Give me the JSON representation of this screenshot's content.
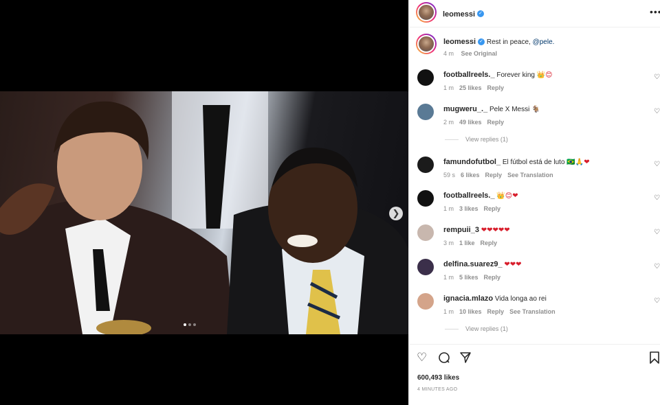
{
  "post": {
    "username": "leomessi",
    "caption_text": "Rest in peace, ",
    "caption_mention": "@pele.",
    "caption_time": "4 m",
    "see_original": "See Original",
    "likes": "600,493 likes",
    "time_ago": "4 MINUTES AGO"
  },
  "carousel": {
    "next": "❯",
    "slides": 3,
    "active_slide": 1
  },
  "comments": [
    {
      "user": "footballreels._",
      "text": "Forever king",
      "emoji": "👑😊",
      "time": "1 m",
      "likes": "25 likes",
      "reply": "Reply",
      "extra": "",
      "avatar": "#111111"
    },
    {
      "user": "mugweru_._",
      "text": "Pele X Messi",
      "emoji": "🐐",
      "time": "2 m",
      "likes": "49 likes",
      "reply": "Reply",
      "extra": "",
      "avatar": "#5a7a95",
      "view_replies": "View replies (1)"
    },
    {
      "user": "famundofutbol_",
      "text": "El fútbol está de luto",
      "emoji": "🇧🇷🙏❤",
      "time": "59 s",
      "likes": "6 likes",
      "reply": "Reply",
      "extra": "See Translation",
      "avatar": "#1b1b1b"
    },
    {
      "user": "footballreels._",
      "text": "",
      "emoji": "👑😊❤",
      "time": "1 m",
      "likes": "3 likes",
      "reply": "Reply",
      "extra": "",
      "avatar": "#111111"
    },
    {
      "user": "rempuii_3",
      "text": "",
      "emoji": "❤❤❤❤❤",
      "time": "3 m",
      "likes": "1 like",
      "reply": "Reply",
      "extra": "",
      "avatar": "#c8b7ae"
    },
    {
      "user": "delfina.suarez9_",
      "text": "",
      "emoji": "❤❤❤",
      "time": "1 m",
      "likes": "5 likes",
      "reply": "Reply",
      "extra": "",
      "avatar": "#3b2f4a"
    },
    {
      "user": "ignacia.mlazo",
      "text": "Vida longa ao rei",
      "emoji": "",
      "time": "1 m",
      "likes": "10 likes",
      "reply": "Reply",
      "extra": "See Translation",
      "avatar": "#d4a48a",
      "view_replies": "View replies (1)"
    }
  ],
  "icons": {
    "like": "heart-icon",
    "comment": "comment-icon",
    "share": "share-icon",
    "save": "bookmark-icon",
    "more": "more-icon",
    "verified": "verified-icon"
  },
  "colors": {
    "accent": "#3897f0",
    "muted": "#8e8e8e",
    "heart": "#d81e2c"
  }
}
